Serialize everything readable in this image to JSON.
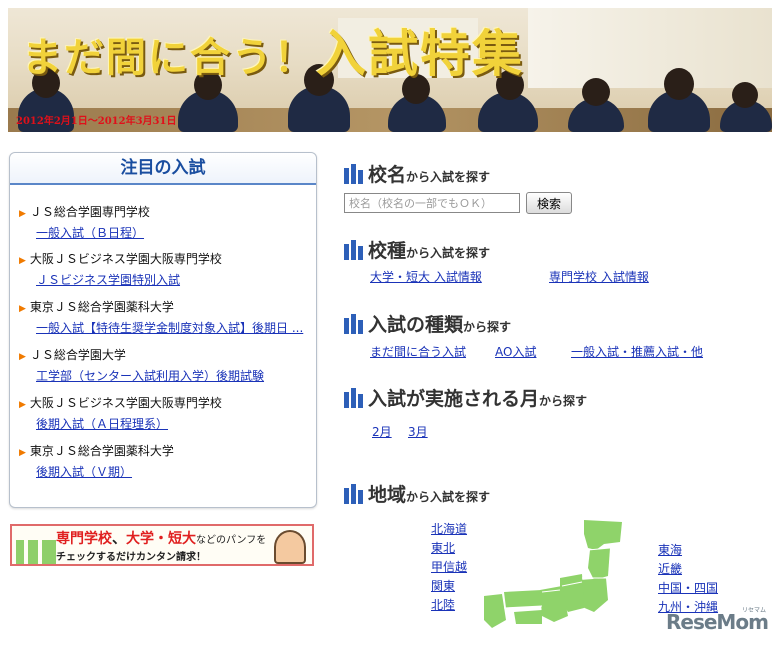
{
  "banner": {
    "title_small": "まだ間に合う！",
    "title_big": "入試特集",
    "date": "2012年2月1日～2012年3月31日"
  },
  "featured": {
    "title": "注目の入試",
    "items": [
      {
        "school": "ＪＳ総合学園専門学校",
        "link": "一般入試（Ｂ日程）"
      },
      {
        "school": "大阪ＪＳビジネス学園大阪専門学校",
        "link": "ＪＳビジネス学園特別入試"
      },
      {
        "school": "東京ＪＳ総合学園薬科大学",
        "link": "一般入試【特待生奨学金制度対象入試】後期日 ..."
      },
      {
        "school": "ＪＳ総合学園大学",
        "link": "工学部（センター入試利用入学）後期試験"
      },
      {
        "school": "大阪ＪＳビジネス学園大阪専門学校",
        "link": "後期入試（Ａ日程理系）"
      },
      {
        "school": "東京ＪＳ総合学園薬科大学",
        "link": "後期入試（Ｖ期）"
      }
    ]
  },
  "pamphlet": {
    "part1": "専門学校",
    "sep1": "、",
    "part2": "大学・短大",
    "part3": "などのパンフを",
    "line2": "チェックするだけカンタン請求！"
  },
  "search": {
    "name": {
      "title": "校名",
      "sub": "から入試を探す",
      "placeholder": "校名（校名の一部でもＯＫ）",
      "button": "検索"
    },
    "type": {
      "title": "校種",
      "sub": "から入試を探す",
      "links": [
        "大学・短大 入試情報",
        "専門学校 入試情報"
      ]
    },
    "kind": {
      "title": "入試の種類",
      "sub": "から探す",
      "links": [
        "まだ間に合う入試",
        "AO入試",
        "一般入試・推薦入試・他"
      ]
    },
    "month": {
      "title": "入試が実施される月",
      "sub": "から探す",
      "links": [
        "2月",
        "3月"
      ]
    },
    "region": {
      "title": "地域",
      "sub": "から入試を探す",
      "left_links": [
        "北海道",
        "東北",
        "甲信越",
        "関東",
        "北陸"
      ],
      "right_links": [
        "東海",
        "近畿",
        "中国・四国",
        "九州・沖縄"
      ]
    }
  },
  "logo": {
    "text": "ReseMom",
    "tiny": "リセマム"
  },
  "colors": {
    "accent": "#2d5fb8",
    "link": "#1a33b8",
    "map": "#8fd36a",
    "banner_title": "#f1d23a"
  }
}
